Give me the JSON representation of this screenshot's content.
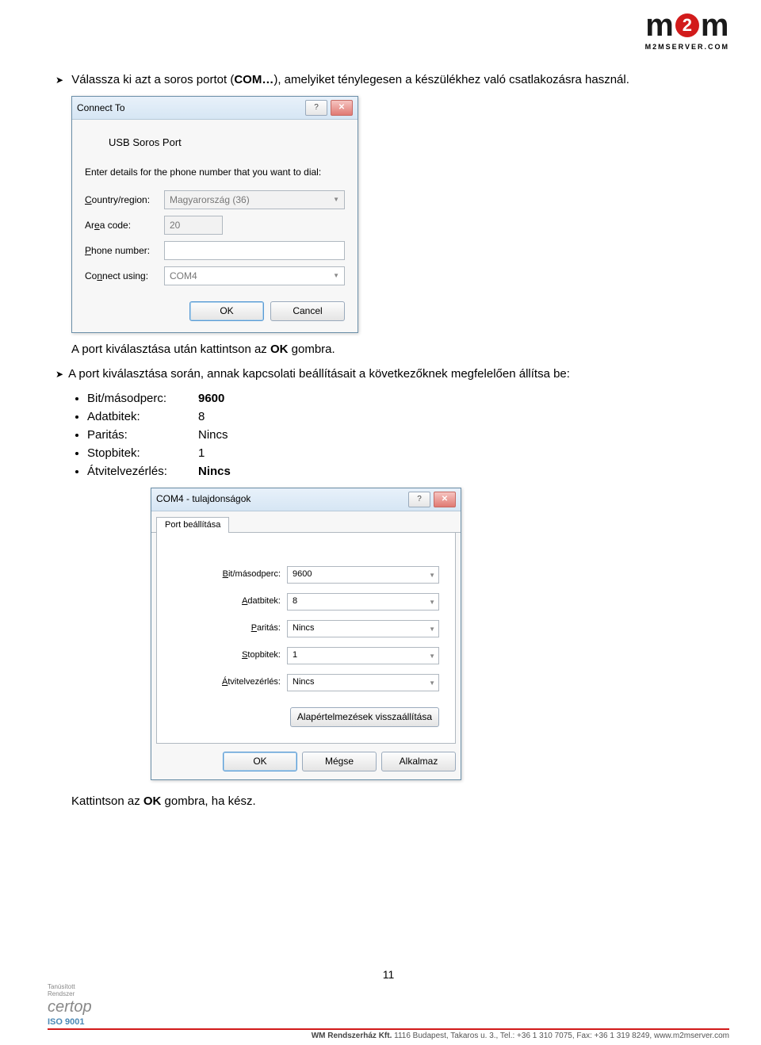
{
  "logo": {
    "m_left": "m",
    "two": "2",
    "m_right": "m",
    "sub": "M2MSERVER.COM"
  },
  "text": {
    "p1_pre": "Válassza ki azt a soros portot (",
    "p1_bold": "COM…",
    "p1_post": "), amelyiket ténylegesen a készülékhez való csatlakozásra használ.",
    "p2_pre": "A port kiválasztása után kattintson az ",
    "p2_bold": "OK",
    "p2_post": " gombra.",
    "p3": "A port kiválasztása során, annak kapcsolati beállításait a következőknek megfelelően állítsa be:",
    "p4_pre": "Kattintson az ",
    "p4_bold": "OK",
    "p4_post": " gombra, ha kész."
  },
  "settings_list": [
    {
      "label": "Bit/másodperc:",
      "value": "9600",
      "bold": true
    },
    {
      "label": "Adatbitek:",
      "value": "8",
      "bold": false
    },
    {
      "label": "Paritás:",
      "value": "Nincs",
      "bold": false
    },
    {
      "label": "Stopbitek:",
      "value": "1",
      "bold": false
    },
    {
      "label": "Átvitelvezérlés:",
      "value": "Nincs",
      "bold": true
    }
  ],
  "dlg1": {
    "title": "Connect To",
    "subtitle": "USB Soros Port",
    "instr": "Enter details for the phone number that you want to dial:",
    "country_label": "Country/region:",
    "country_value": "Magyarország (36)",
    "area_label": "Area code:",
    "area_value": "20",
    "phone_label": "Phone number:",
    "phone_value": "",
    "connect_label": "Connect using:",
    "connect_value": "COM4",
    "ok": "OK",
    "cancel": "Cancel",
    "help_btn": "?",
    "close_btn": "✕"
  },
  "dlg2": {
    "title": "COM4 - tulajdonságok",
    "tab": "Port beállítása",
    "rows": [
      {
        "label": "Bit/másodperc:",
        "value": "9600"
      },
      {
        "label": "Adatbitek:",
        "value": "8"
      },
      {
        "label": "Paritás:",
        "value": "Nincs"
      },
      {
        "label": "Stopbitek:",
        "value": "1"
      },
      {
        "label": "Átvitelvezérlés:",
        "value": "Nincs"
      }
    ],
    "reset": "Alapértelmezések visszaállítása",
    "ok": "OK",
    "cancel": "Mégse",
    "apply": "Alkalmaz",
    "help_btn": "?",
    "close_btn": "✕"
  },
  "footer": {
    "page": "11",
    "cert1": "Tanúsított",
    "cert2": "Rendszer",
    "certop": "certop",
    "iso": "ISO 9001",
    "company": "WM Rendszerház Kft.",
    "addr": " 1116 Budapest, Takaros u. 3., Tel.: +36 1 310 7075, Fax: +36 1 319 8249, www.m2mserver.com"
  }
}
